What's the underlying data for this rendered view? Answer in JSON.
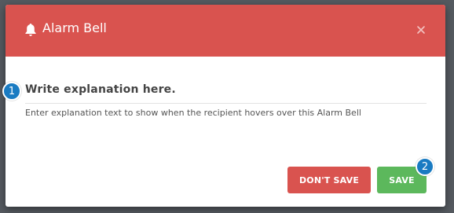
{
  "colors": {
    "header_bg": "#d9534f",
    "dont_save_bg": "#d9534f",
    "save_bg": "#5cb85c",
    "callout_bg": "#1a7bc2"
  },
  "dialog": {
    "title": "Alarm Bell",
    "title_icon": "bell-icon",
    "close_icon": "close-icon",
    "explanation_title": "Write explanation here.",
    "explanation_text": "Enter explanation text to show when the recipient hovers over this Alarm Bell"
  },
  "buttons": {
    "dont_save_label": "DON'T SAVE",
    "save_label": "SAVE"
  },
  "callouts": [
    "1",
    "2"
  ]
}
